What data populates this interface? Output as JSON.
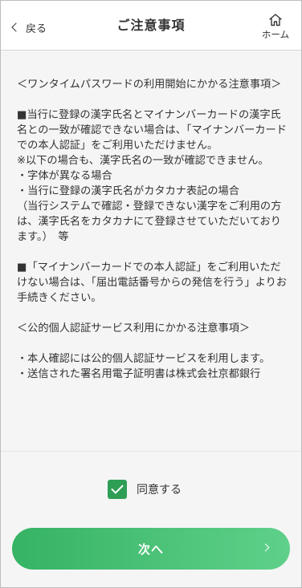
{
  "header": {
    "back_label": "戻る",
    "title": "ご注意事項",
    "home_label": "ホーム"
  },
  "notice": {
    "paragraphs": [
      "＜ワンタイムパスワードの利用開始にかかる注意事項＞",
      "■当行に登録の漢字氏名とマイナンバーカードの漢字氏名との一致が確認できない場合は、「マイナンバーカードでの本人認証」をご利用いただけません。\n※以下の場合も、漢字氏名の一致が確認できません。\n・字体が異なる場合\n・当行に登録の漢字氏名がカタカナ表記の場合\n（当行システムで確認・登録できない漢字をご利用の方は、漢字氏名をカタカナにて登録させていただいております。）　等",
      "■「マイナンバーカードでの本人認証」をご利用いただけない場合は、「届出電話番号からの発信を行う」よりお手続きください。",
      "＜公的個人認証サービス利用にかかる注意事項＞",
      "・本人確認には公的個人認証サービスを利用します。\n・送信された署名用電子証明書は株式会社京都銀行"
    ]
  },
  "agree": {
    "checked": true,
    "label": "同意する"
  },
  "next_button": {
    "label": "次へ"
  },
  "colors": {
    "accent": "#2e9e55",
    "button_start": "#36b364",
    "button_end": "#5fd08a",
    "content_bg": "#f5f5f5"
  }
}
